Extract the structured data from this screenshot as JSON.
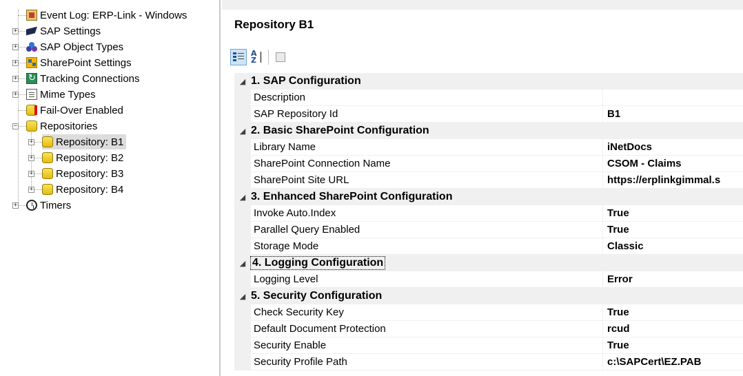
{
  "tree": {
    "items": [
      {
        "label": "Event Log: ERP-Link - Windows",
        "icon": "event-log-icon"
      },
      {
        "label": "SAP Settings",
        "icon": "sap-settings-icon"
      },
      {
        "label": "SAP Object Types",
        "icon": "object-types-icon"
      },
      {
        "label": "SharePoint Settings",
        "icon": "sharepoint-icon"
      },
      {
        "label": "Tracking Connections",
        "icon": "tracking-icon"
      },
      {
        "label": "Mime Types",
        "icon": "mime-icon"
      },
      {
        "label": "Fail-Over Enabled",
        "icon": "database-failover-icon"
      },
      {
        "label": "Repositories",
        "icon": "database-icon"
      },
      {
        "label": "Repository: B1",
        "icon": "database-icon",
        "selected": true
      },
      {
        "label": "Repository: B2",
        "icon": "database-icon"
      },
      {
        "label": "Repository: B3",
        "icon": "database-icon"
      },
      {
        "label": "Repository: B4",
        "icon": "database-icon"
      },
      {
        "label": "Timers",
        "icon": "clock-icon"
      }
    ]
  },
  "header": {
    "title": "Repository B1"
  },
  "toolbar": {
    "buttons": [
      {
        "icon": "categorized-icon",
        "active": true
      },
      {
        "icon": "sort-az-icon",
        "active": false
      },
      {
        "icon": "property-pages-icon",
        "active": false,
        "disabled": true
      }
    ],
    "az_top": "A",
    "az_bottom": "Z"
  },
  "grid": {
    "categories": [
      {
        "label": "1. SAP Configuration",
        "props": [
          {
            "name": "Description",
            "value": ""
          },
          {
            "name": "SAP Repository Id",
            "value": "B1"
          }
        ]
      },
      {
        "label": "2. Basic SharePoint Configuration",
        "props": [
          {
            "name": "Library Name",
            "value": "iNetDocs"
          },
          {
            "name": "SharePoint Connection Name",
            "value": "CSOM - Claims"
          },
          {
            "name": "SharePoint Site URL",
            "value": "https://erplinkgimmal.s"
          }
        ]
      },
      {
        "label": "3. Enhanced SharePoint Configuration",
        "props": [
          {
            "name": "Invoke Auto.Index",
            "value": "True"
          },
          {
            "name": "Parallel Query Enabled",
            "value": "True"
          },
          {
            "name": "Storage Mode",
            "value": "Classic"
          }
        ]
      },
      {
        "label": "4. Logging Configuration",
        "focused": true,
        "props": [
          {
            "name": "Logging Level",
            "value": "Error"
          }
        ]
      },
      {
        "label": "5. Security Configuration",
        "props": [
          {
            "name": "Check Security Key",
            "value": "True"
          },
          {
            "name": "Default Document Protection",
            "value": "rcud"
          },
          {
            "name": "Security Enable",
            "value": "True"
          },
          {
            "name": "Security Profile Path",
            "value": "c:\\SAPCert\\EZ.PAB"
          }
        ]
      }
    ],
    "collapse_glyph": "◢"
  }
}
